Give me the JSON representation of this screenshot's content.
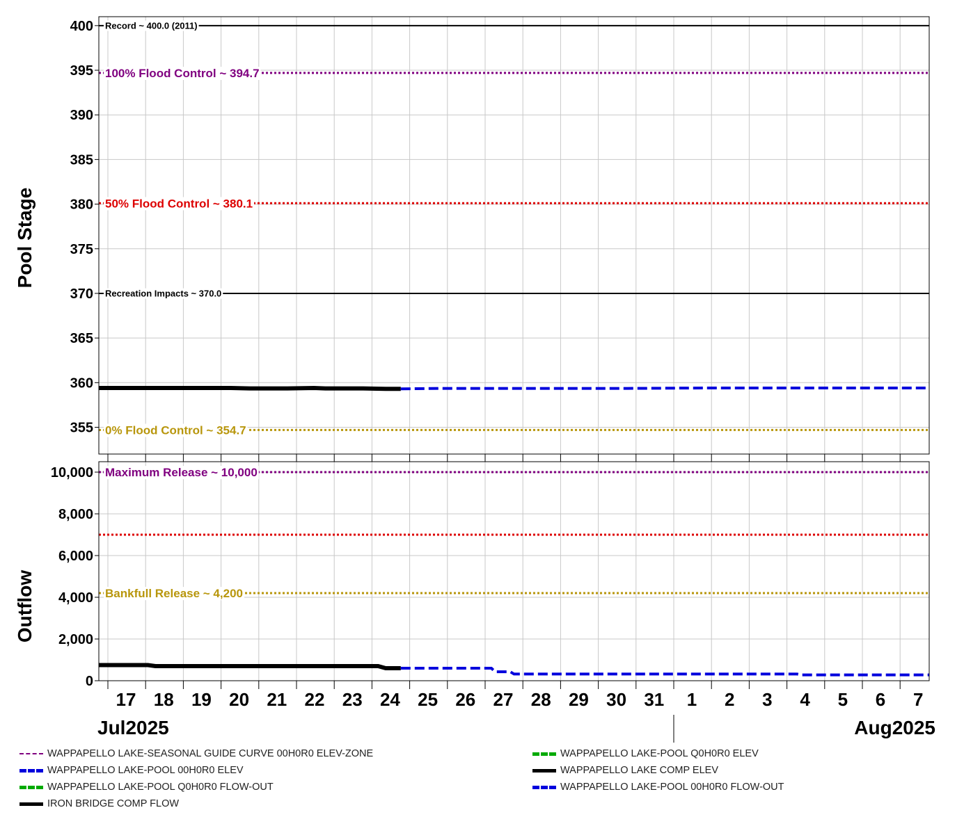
{
  "chart_data": [
    {
      "type": "line",
      "ylabel": "Pool Stage",
      "ylim": [
        352,
        401
      ],
      "y_ticks": [
        "355",
        "360",
        "365",
        "370",
        "375",
        "380",
        "385",
        "390",
        "395",
        "400"
      ],
      "y_tick_values": [
        355,
        360,
        365,
        370,
        375,
        380,
        385,
        390,
        395,
        400
      ],
      "reference_lines": [
        {
          "label": "Record ~ 400.0 (2011)",
          "value": 400.0,
          "color": "#000000",
          "style": "solid",
          "label_size": "small"
        },
        {
          "label": "100% Flood Control ~ 394.7",
          "value": 394.7,
          "color": "#800080",
          "style": "dotted",
          "label_size": "large"
        },
        {
          "label": "50% Flood Control ~ 380.1",
          "value": 380.1,
          "color": "#dd0000",
          "style": "dotted",
          "label_size": "large"
        },
        {
          "label": "Recreation Impacts ~ 370.0",
          "value": 370.0,
          "color": "#000000",
          "style": "solid",
          "label_size": "small"
        },
        {
          "label": "0% Flood Control ~ 354.7",
          "value": 354.7,
          "color": "#b8960c",
          "style": "dotted",
          "label_size": "large"
        }
      ],
      "series": [
        {
          "name": "WAPPAPELLO LAKE COMP ELEV",
          "color": "#000000",
          "style": "solid",
          "x": [
            "2025-07-16",
            "2025-07-18",
            "2025-07-19.5",
            "2025-07-20",
            "2025-07-21",
            "2025-07-21.7",
            "2025-07-22",
            "2025-07-23",
            "2025-07-23.6",
            "2025-07-24"
          ],
          "y": [
            359.4,
            359.4,
            359.4,
            359.35,
            359.35,
            359.4,
            359.35,
            359.35,
            359.3,
            359.3
          ]
        },
        {
          "name": "WAPPAPELLO LAKE-POOL 00H0R0 ELEV",
          "color": "#0000dd",
          "style": "dashed",
          "x": [
            "2025-07-24",
            "2025-07-25",
            "2025-07-27",
            "2025-07-30",
            "2025-08-01",
            "2025-08-04",
            "2025-08-07"
          ],
          "y": [
            359.3,
            359.35,
            359.35,
            359.35,
            359.4,
            359.4,
            359.4
          ]
        }
      ]
    },
    {
      "type": "line",
      "ylabel": "Outflow",
      "ylim": [
        0,
        10500
      ],
      "y_ticks": [
        "0",
        "2,000",
        "4,000",
        "6,000",
        "8,000",
        "10,000"
      ],
      "y_tick_values": [
        0,
        2000,
        4000,
        6000,
        8000,
        10000
      ],
      "reference_lines": [
        {
          "label": "Maximum Release ~ 10,000",
          "value": 10000,
          "color": "#800080",
          "style": "dotted",
          "label_size": "large"
        },
        {
          "label": "",
          "value": 7000,
          "color": "#dd0000",
          "style": "dotted",
          "label_size": "large"
        },
        {
          "label": "Bankfull Release ~ 4,200",
          "value": 4200,
          "color": "#b8960c",
          "style": "dotted",
          "label_size": "large"
        }
      ],
      "series": [
        {
          "name": "IRON BRIDGE COMP FLOW",
          "color": "#000000",
          "style": "solid",
          "x": [
            "2025-07-16",
            "2025-07-17.3",
            "2025-07-17.5",
            "2025-07-23.4",
            "2025-07-23.6",
            "2025-07-24"
          ],
          "y": [
            750,
            750,
            700,
            700,
            600,
            600
          ]
        },
        {
          "name": "WAPPAPELLO LAKE-POOL 00H0R0 FLOW-OUT",
          "color": "#0000dd",
          "style": "dashed",
          "x": [
            "2025-07-24",
            "2025-07-26.4",
            "2025-07-26.5",
            "2025-07-26.9",
            "2025-07-27",
            "2025-08-03.5",
            "2025-08-03.6",
            "2025-08-07"
          ],
          "y": [
            600,
            600,
            430,
            430,
            320,
            320,
            280,
            280
          ]
        }
      ]
    }
  ],
  "x_axis": {
    "start": "2025-07-16",
    "end": "2025-08-07",
    "ticks": [
      "17",
      "18",
      "19",
      "20",
      "21",
      "22",
      "23",
      "24",
      "25",
      "26",
      "27",
      "28",
      "29",
      "30",
      "31",
      "1",
      "2",
      "3",
      "4",
      "5",
      "6",
      "7"
    ],
    "months": [
      "Jul2025",
      "Aug2025"
    ]
  },
  "legend": [
    {
      "label": "WAPPAPELLO LAKE-SEASONAL GUIDE CURVE 00H0R0 ELEV-ZONE",
      "color": "#800080",
      "style": "dashdot"
    },
    {
      "label": "WAPPAPELLO LAKE-POOL 00H0R0 ELEV",
      "color": "#0000dd",
      "style": "dashed"
    },
    {
      "label": "WAPPAPELLO LAKE-POOL Q0H0R0 FLOW-OUT",
      "color": "#00aa00",
      "style": "dashed"
    },
    {
      "label": "IRON BRIDGE COMP FLOW",
      "color": "#000000",
      "style": "solid"
    },
    {
      "label": "WAPPAPELLO LAKE-POOL Q0H0R0 ELEV",
      "color": "#00aa00",
      "style": "dashed"
    },
    {
      "label": "WAPPAPELLO LAKE COMP ELEV",
      "color": "#000000",
      "style": "solid"
    },
    {
      "label": "WAPPAPELLO LAKE-POOL 00H0R0 FLOW-OUT",
      "color": "#0000dd",
      "style": "dashed"
    }
  ]
}
